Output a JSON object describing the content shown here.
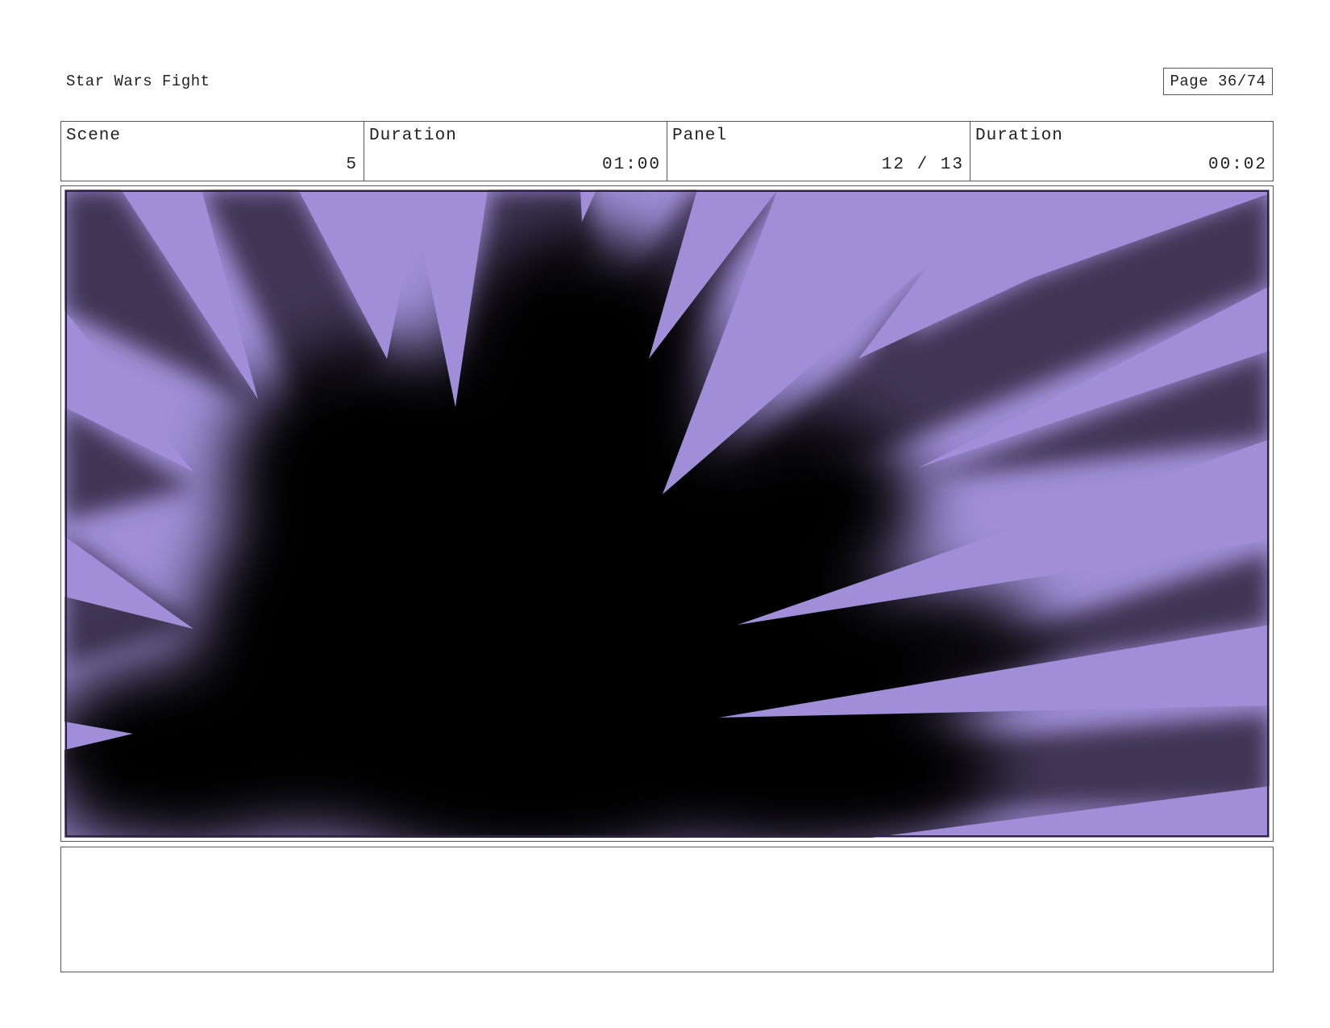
{
  "header": {
    "title": "Star Wars Fight",
    "page": "Page 36/74"
  },
  "info": {
    "scene_label": "Scene",
    "scene_value": "5",
    "scene_duration_label": "Duration",
    "scene_duration_value": "01:00",
    "panel_label": "Panel",
    "panel_value": "12 / 13",
    "panel_duration_label": "Duration",
    "panel_duration_value": "00:02"
  },
  "panel": {
    "colors": {
      "sky": "#a08fd8",
      "burst": "#000000",
      "ray": "#3f3654"
    }
  },
  "notes": {
    "text": ""
  }
}
